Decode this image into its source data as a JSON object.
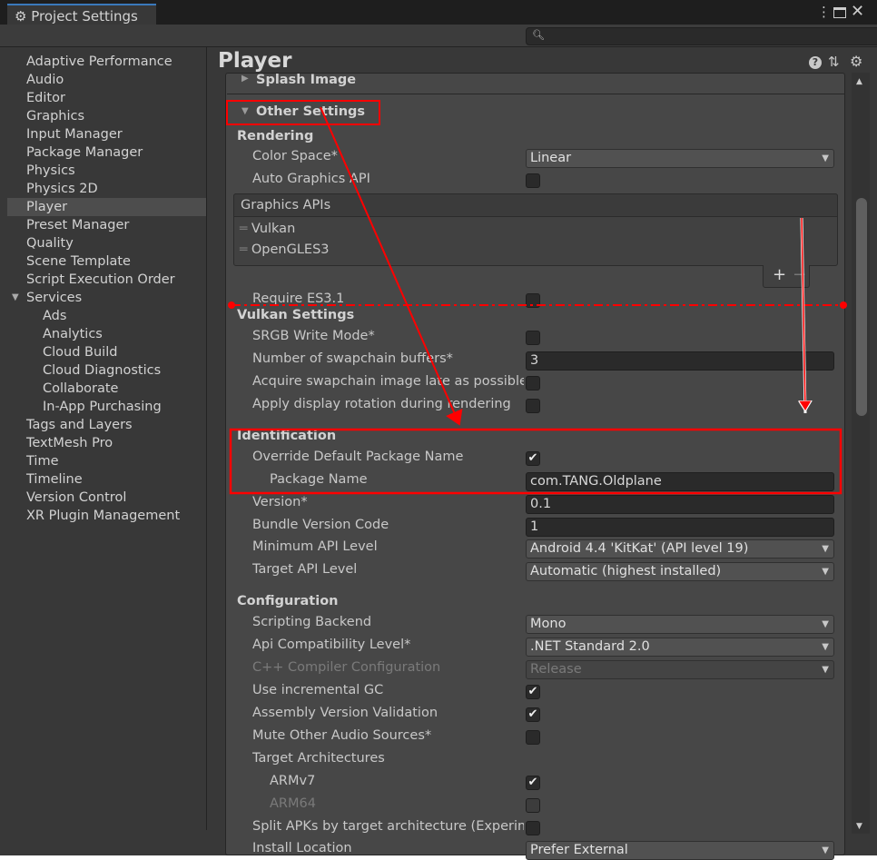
{
  "window": {
    "tab_title": "Project Settings",
    "search_placeholder": ""
  },
  "sidebar": {
    "items": [
      {
        "label": "Adaptive Performance"
      },
      {
        "label": "Audio"
      },
      {
        "label": "Editor"
      },
      {
        "label": "Graphics"
      },
      {
        "label": "Input Manager"
      },
      {
        "label": "Package Manager"
      },
      {
        "label": "Physics"
      },
      {
        "label": "Physics 2D"
      },
      {
        "label": "Player",
        "selected": true
      },
      {
        "label": "Preset Manager"
      },
      {
        "label": "Quality"
      },
      {
        "label": "Scene Template"
      },
      {
        "label": "Script Execution Order"
      },
      {
        "label": "Services",
        "expanded": true
      },
      {
        "label": "Ads",
        "child": true
      },
      {
        "label": "Analytics",
        "child": true
      },
      {
        "label": "Cloud Build",
        "child": true
      },
      {
        "label": "Cloud Diagnostics",
        "child": true
      },
      {
        "label": "Collaborate",
        "child": true
      },
      {
        "label": "In-App Purchasing",
        "child": true
      },
      {
        "label": "Tags and Layers"
      },
      {
        "label": "TextMesh Pro"
      },
      {
        "label": "Time"
      },
      {
        "label": "Timeline"
      },
      {
        "label": "Version Control"
      },
      {
        "label": "XR Plugin Management"
      }
    ]
  },
  "main": {
    "title": "Player",
    "foldouts": {
      "splash": "Splash Image",
      "other": "Other Settings"
    },
    "graphics_apis": {
      "header": "Graphics APIs",
      "items": [
        "Vulkan",
        "OpenGLES3"
      ],
      "add": "+",
      "remove": "−"
    },
    "rows": [
      {
        "type": "section",
        "label": "Rendering"
      },
      {
        "type": "dropdown",
        "label": "Color Space*",
        "value": "Linear"
      },
      {
        "type": "check",
        "label": "Auto Graphics API",
        "checked": false
      },
      {
        "type": "check",
        "label": "Require ES3.1",
        "checked": false
      },
      {
        "type": "section",
        "label": "Vulkan Settings"
      },
      {
        "type": "check",
        "label": "SRGB Write Mode*",
        "checked": false
      },
      {
        "type": "field",
        "label": "Number of swapchain buffers*",
        "value": "3"
      },
      {
        "type": "check",
        "label": "Acquire swapchain image late as possible",
        "checked": false
      },
      {
        "type": "check",
        "label": "Apply display rotation during rendering",
        "checked": false
      },
      {
        "type": "section",
        "label": "Identification"
      },
      {
        "type": "check",
        "label": "Override Default Package Name",
        "checked": true
      },
      {
        "type": "field",
        "label": "Package Name",
        "value": "com.TANG.Oldplane",
        "indent": true
      },
      {
        "type": "field",
        "label": "Version*",
        "value": "0.1"
      },
      {
        "type": "field",
        "label": "Bundle Version Code",
        "value": "1"
      },
      {
        "type": "dropdown",
        "label": "Minimum API Level",
        "value": "Android 4.4 'KitKat' (API level 19)"
      },
      {
        "type": "dropdown",
        "label": "Target API Level",
        "value": "Automatic (highest installed)"
      },
      {
        "type": "section",
        "label": "Configuration"
      },
      {
        "type": "dropdown",
        "label": "Scripting Backend",
        "value": "Mono"
      },
      {
        "type": "dropdown",
        "label": "Api Compatibility Level*",
        "value": ".NET Standard 2.0"
      },
      {
        "type": "dropdown",
        "label": "C++ Compiler Configuration",
        "value": "Release",
        "disabled": true
      },
      {
        "type": "check",
        "label": "Use incremental GC",
        "checked": true
      },
      {
        "type": "check",
        "label": "Assembly Version Validation",
        "checked": true
      },
      {
        "type": "check",
        "label": "Mute Other Audio Sources*",
        "checked": false
      },
      {
        "type": "label",
        "label": "Target Architectures"
      },
      {
        "type": "check",
        "label": "ARMv7",
        "checked": true,
        "indent": true
      },
      {
        "type": "check",
        "label": "ARM64",
        "checked": false,
        "indent": true,
        "disabled": true
      },
      {
        "type": "check",
        "label": "Split APKs by target architecture (Experimental)",
        "checked": false
      },
      {
        "type": "dropdown",
        "label": "Install Location",
        "value": "Prefer External"
      }
    ]
  },
  "annotation_color": "#ff0000"
}
